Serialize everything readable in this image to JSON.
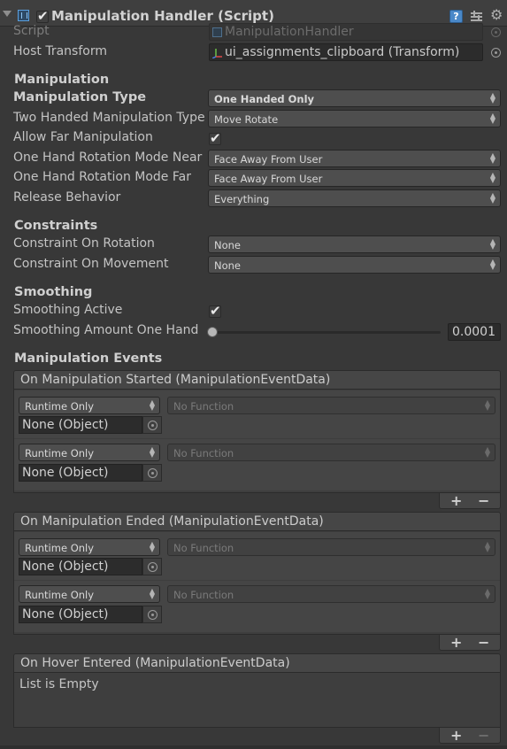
{
  "header": {
    "title": "Manipulation Handler (Script)",
    "enabled": true
  },
  "fields": {
    "script_label": "Script",
    "script_value": "ManipulationHandler",
    "host_transform_label": "Host Transform",
    "host_transform_value": "ui_assignments_clipboard (Transform)"
  },
  "manipulation": {
    "section_title": "Manipulation",
    "type_label": "Manipulation Type",
    "type_value": "One Handed Only",
    "two_handed_label": "Two Handed Manipulation Type",
    "two_handed_value": "Move Rotate",
    "allow_far_label": "Allow Far Manipulation",
    "allow_far_checked": true,
    "rotation_near_label": "One Hand Rotation Mode Near",
    "rotation_near_value": "Face Away From User",
    "rotation_far_label": "One Hand Rotation Mode Far",
    "rotation_far_value": "Face Away From User",
    "release_label": "Release Behavior",
    "release_value": "Everything"
  },
  "constraints": {
    "section_title": "Constraints",
    "rotation_label": "Constraint On Rotation",
    "rotation_value": "None",
    "movement_label": "Constraint On Movement",
    "movement_value": "None"
  },
  "smoothing": {
    "section_title": "Smoothing",
    "active_label": "Smoothing Active",
    "active_checked": true,
    "amount_label": "Smoothing Amount One Hand",
    "amount_value": "0.0001",
    "amount_fraction": 0.0001
  },
  "events": {
    "section_title": "Manipulation Events",
    "started": {
      "title": "On Manipulation Started (ManipulationEventData)",
      "items": [
        {
          "mode": "Runtime Only",
          "function": "No Function",
          "object": "None (Object)"
        },
        {
          "mode": "Runtime Only",
          "function": "No Function",
          "object": "None (Object)"
        }
      ]
    },
    "ended": {
      "title": "On Manipulation Ended (ManipulationEventData)",
      "items": [
        {
          "mode": "Runtime Only",
          "function": "No Function",
          "object": "None (Object)"
        },
        {
          "mode": "Runtime Only",
          "function": "No Function",
          "object": "None (Object)"
        }
      ]
    },
    "hover_entered": {
      "title": "On Hover Entered (ManipulationEventData)",
      "empty_text": "List is Empty"
    },
    "add_symbol": "+",
    "remove_symbol": "−"
  },
  "icons": {
    "foldout": "triangle-down-icon",
    "component": "script-icon",
    "help": "help-icon",
    "presets": "presets-icon",
    "settings": "gear-icon",
    "object_picker": "object-picker-icon",
    "transform": "transform-icon",
    "check": "✔",
    "dropdown_arrows": "▲▼"
  },
  "colors": {
    "background": "#383838",
    "field": "#2c2c2c",
    "dropdown": "#4e4e4e",
    "text": "#c4c4c4",
    "help_blue": "#4a88c8"
  }
}
